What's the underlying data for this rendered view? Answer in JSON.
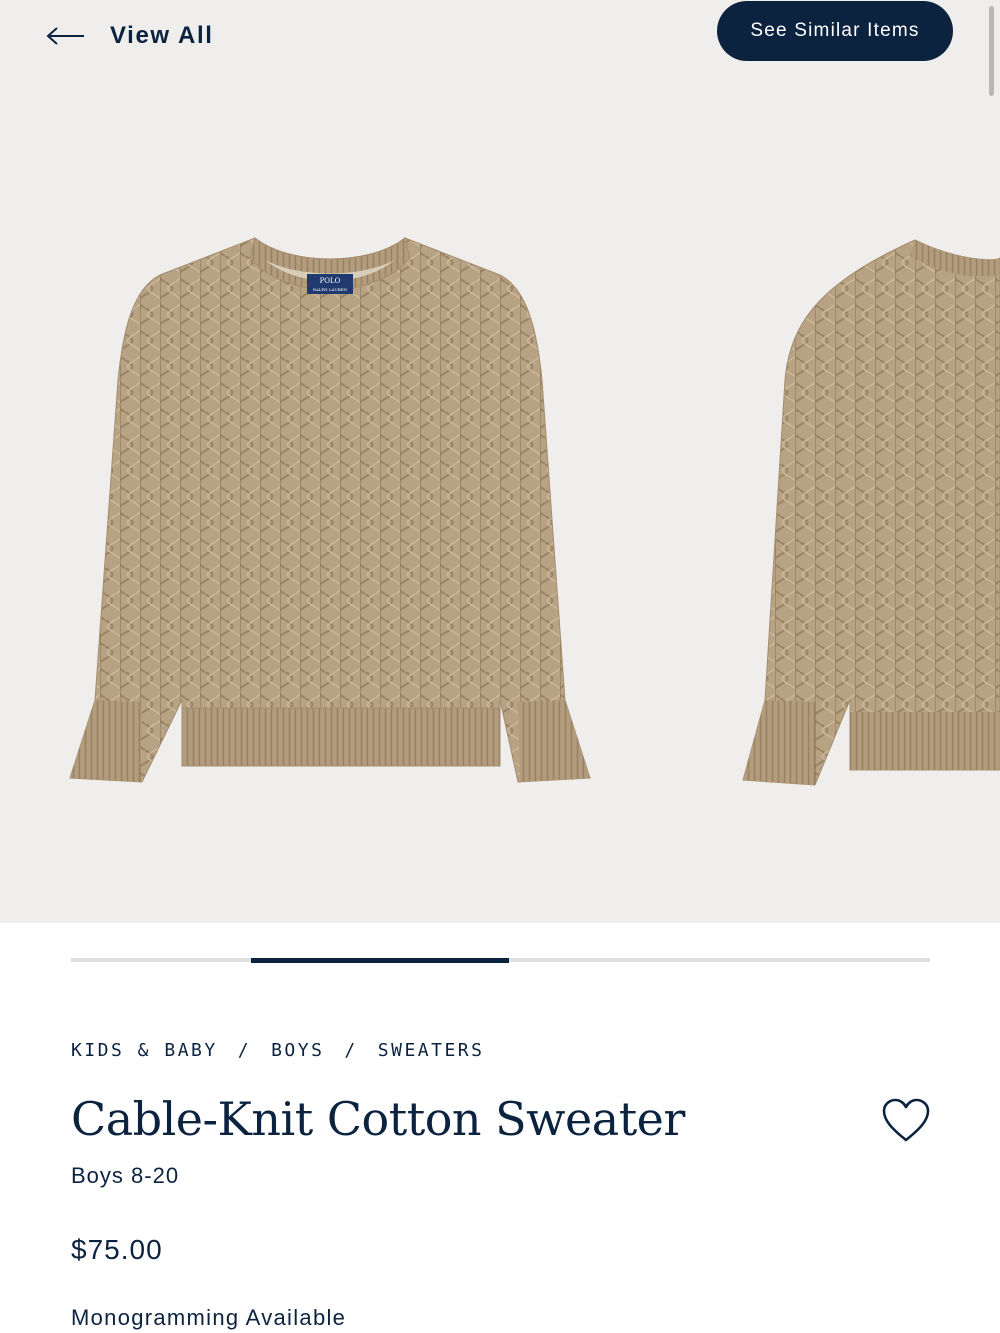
{
  "header": {
    "back_label": "View All",
    "similar_label": "See Similar Items"
  },
  "gallery": {
    "images": [
      {
        "name": "front-view",
        "label_line1": "POLO",
        "label_line2": "RALPH LAUREN"
      },
      {
        "name": "alternate-view"
      }
    ],
    "progress": {
      "segments": 3,
      "active_index": 1
    }
  },
  "breadcrumb": [
    "KIDS & BABY",
    "BOYS",
    "SWEATERS"
  ],
  "product": {
    "title": "Cable-Knit Cotton Sweater",
    "subtitle": "Boys 8-20",
    "price": "$75.00",
    "monogram": "Monogramming Available"
  },
  "icons": {
    "back": "arrow-left-icon",
    "favorite": "heart-icon"
  },
  "colors": {
    "navy": "#0c2340",
    "hero_bg": "#f0eeec",
    "sweater": "#b9a385",
    "track": "#dedede"
  }
}
